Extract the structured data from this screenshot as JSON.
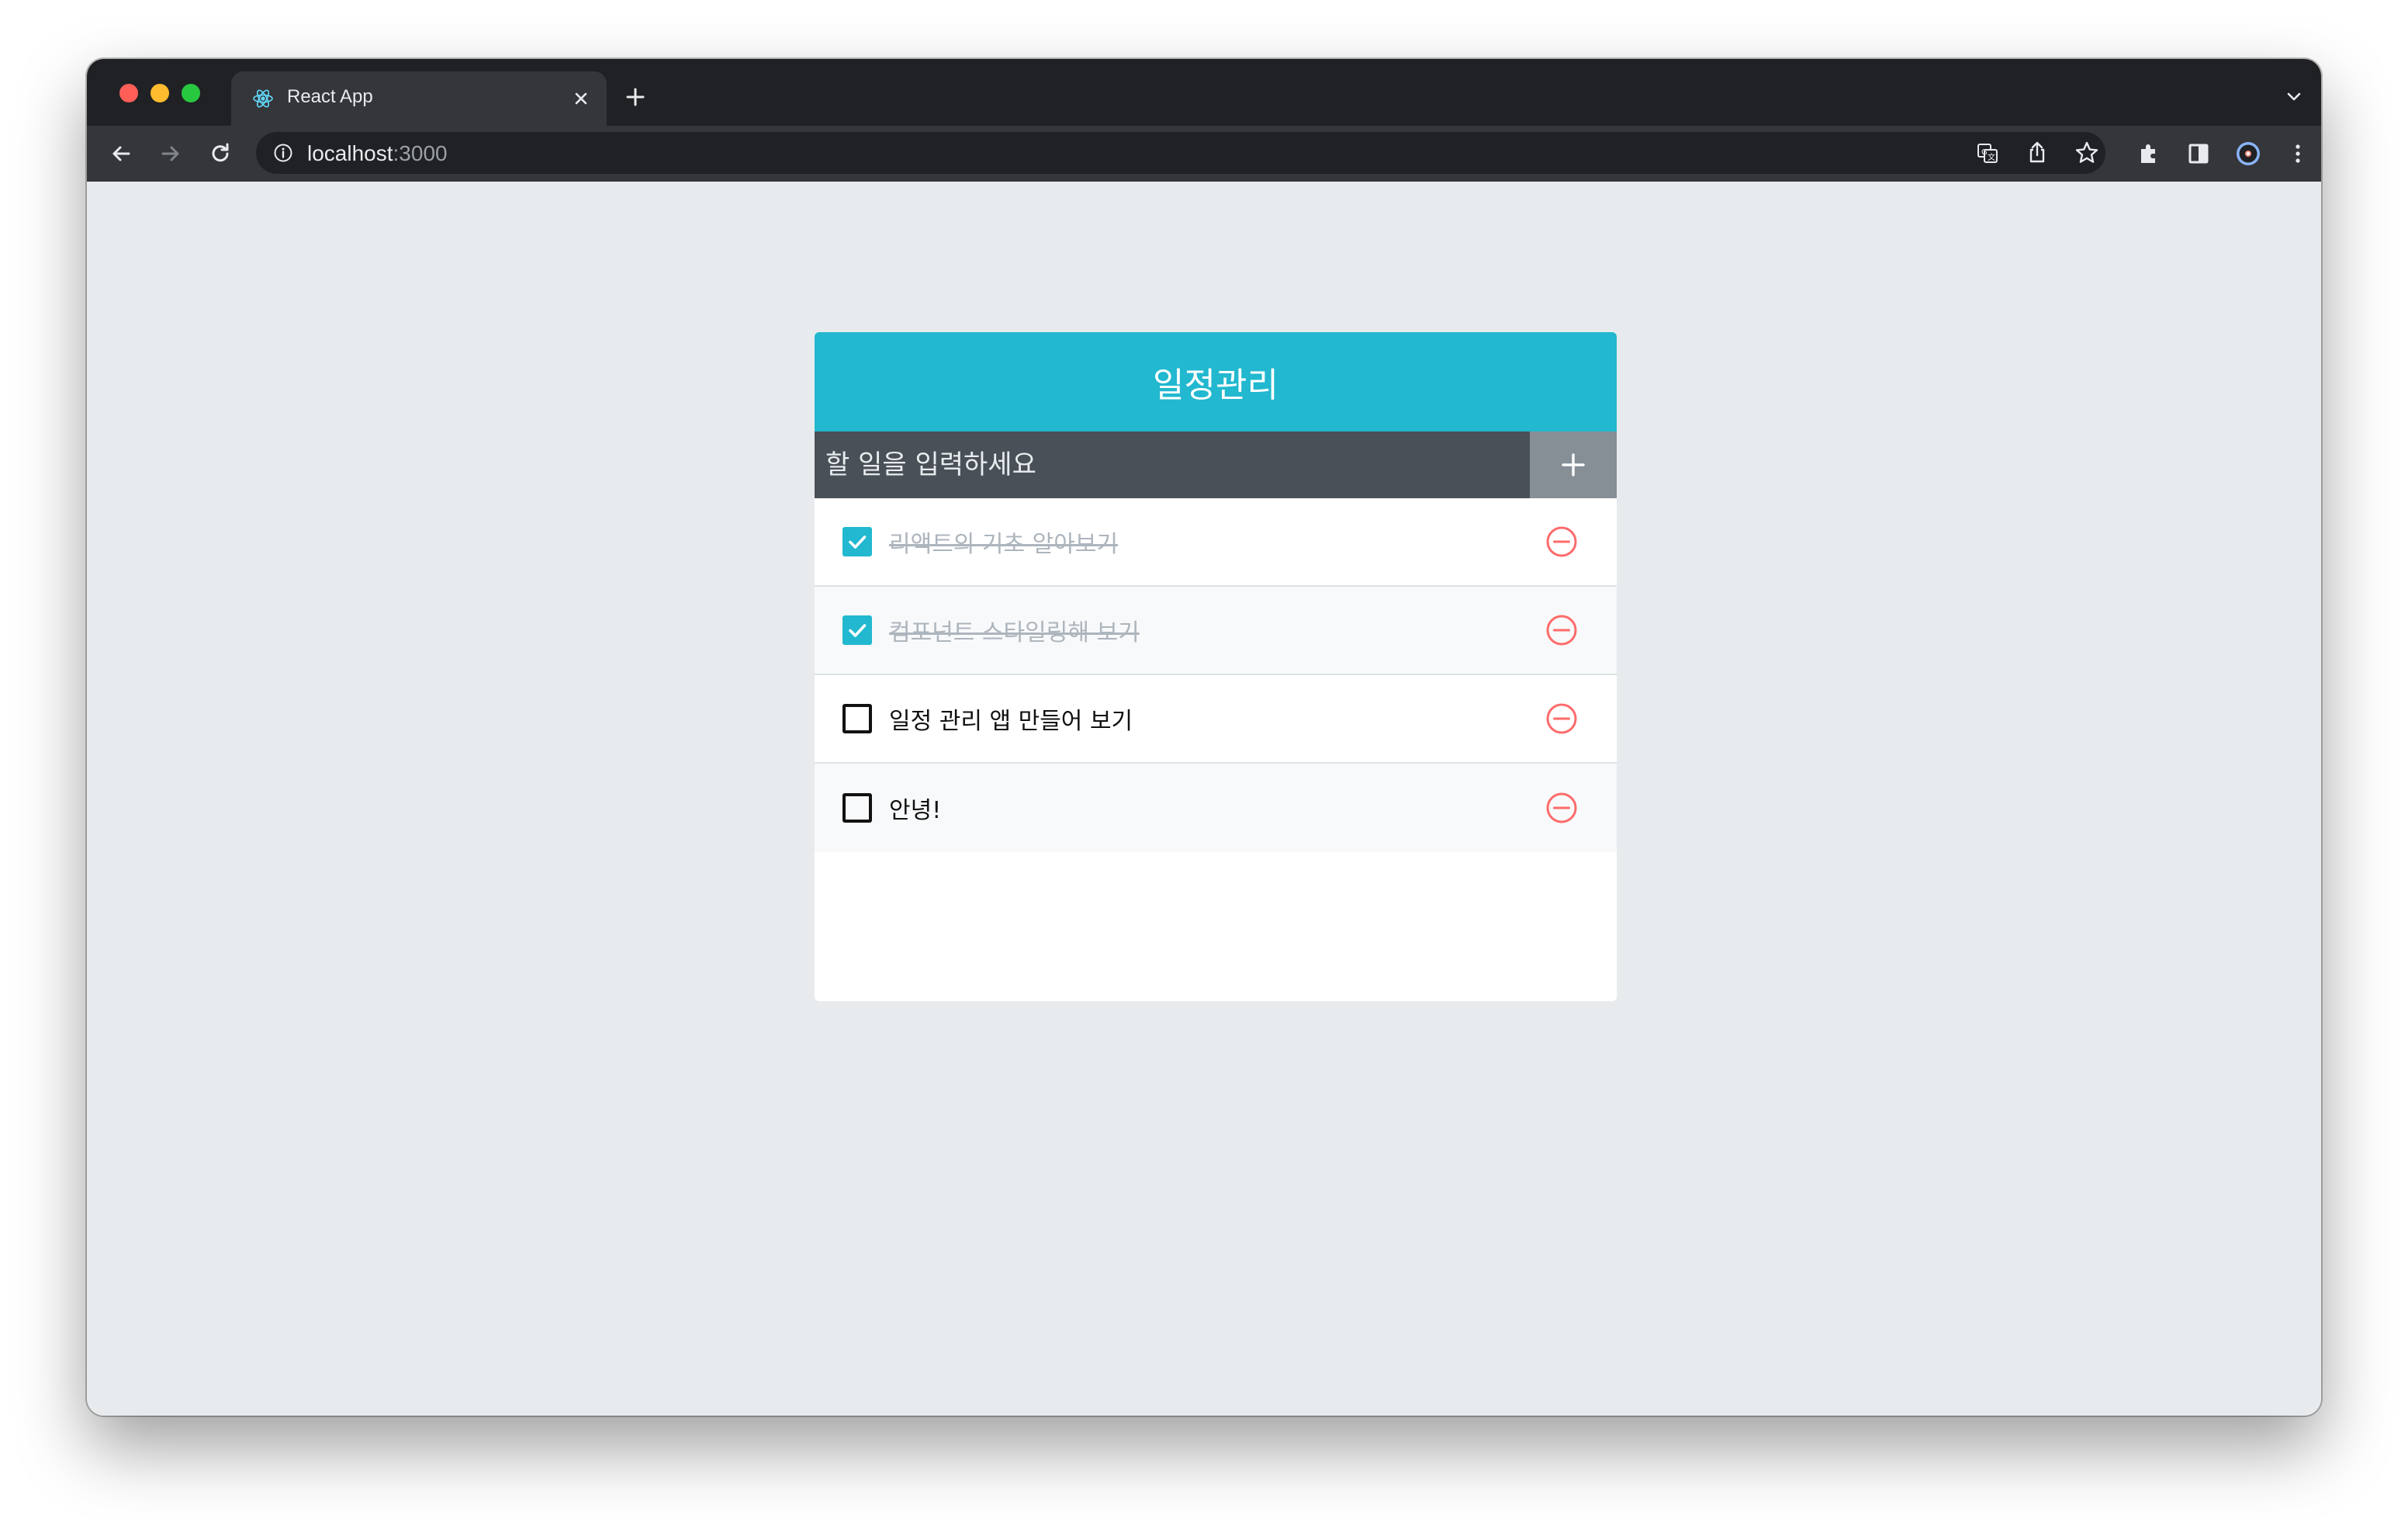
{
  "browser": {
    "tab_title": "React App",
    "url_host": "localhost",
    "url_port": ":3000"
  },
  "app": {
    "title": "일정관리",
    "input_placeholder": "할 일을 입력하세요",
    "todos": [
      {
        "text": "리액트의 기초 알아보기",
        "checked": true
      },
      {
        "text": "컴포넌트 스타일링해 보기",
        "checked": true
      },
      {
        "text": "일정 관리 앱 만들어 보기",
        "checked": false
      },
      {
        "text": "안녕!",
        "checked": false
      }
    ]
  },
  "colors": {
    "header": "#22b8cf",
    "input_bar": "#495057",
    "add_button": "#868e96",
    "remove_icon": "#ff6b6b",
    "checked_text": "#adb5bd"
  },
  "icons": {
    "favicon": "react-icon",
    "add": "plus-icon",
    "remove": "minus-circle-icon",
    "checked": "checkbox-checked-icon",
    "unchecked": "checkbox-blank-icon"
  }
}
